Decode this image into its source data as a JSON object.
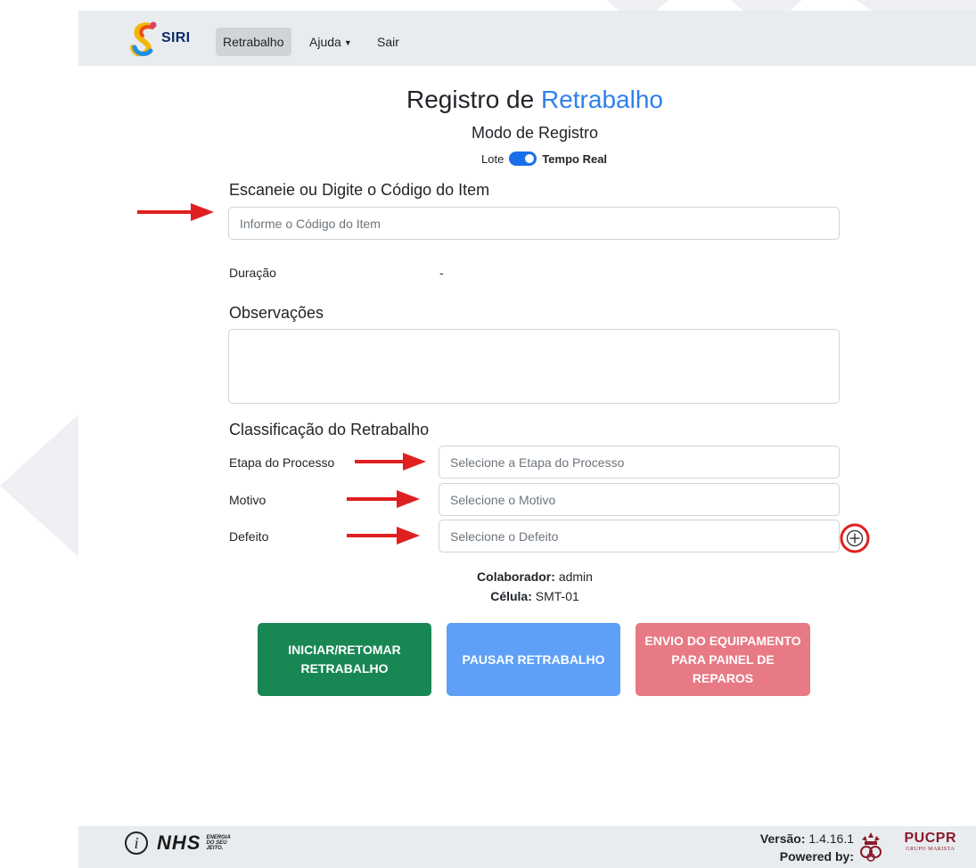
{
  "navbar": {
    "brand": "SIRI",
    "items": [
      {
        "label": "Retrabalho",
        "active": true
      },
      {
        "label": "Ajuda"
      },
      {
        "label": "Sair"
      }
    ]
  },
  "page": {
    "title_prefix": "Registro de",
    "title_accent": "Retrabalho",
    "subtitle": "Modo de Registro",
    "mode_off_label": "Lote",
    "mode_on_label": "Tempo Real",
    "mode_toggle_on": true
  },
  "item_code": {
    "label": "Escaneie ou Digite o Código do Item",
    "placeholder": "Informe o Código do Item",
    "value": ""
  },
  "duration": {
    "label": "Duração",
    "value": "-"
  },
  "observations": {
    "label": "Observações",
    "value": ""
  },
  "classification": {
    "title": "Classificação do Retrabalho",
    "fields": [
      {
        "label": "Etapa do Processo",
        "placeholder": "Selecione a Etapa do Processo"
      },
      {
        "label": "Motivo",
        "placeholder": "Selecione o Motivo"
      },
      {
        "label": "Defeito",
        "placeholder": "Selecione o Defeito"
      }
    ],
    "add_icon": "plus-circle-icon"
  },
  "info": {
    "collaborator_label": "Colaborador:",
    "collaborator_value": "admin",
    "cell_label": "Célula:",
    "cell_value": "SMT-01"
  },
  "actions": {
    "start": {
      "label": "INICIAR/RETOMAR RETRABALHO",
      "color": "#198754"
    },
    "pause": {
      "label": "PAUSAR RETRABALHO",
      "color": "#5ea0f7"
    },
    "send": {
      "label": "ENVIO DO EQUIPAMENTO PARA PAINEL DE REPAROS",
      "color": "#e77a84"
    }
  },
  "footer": {
    "info_icon": "info-icon",
    "nhs_mark": "NHS",
    "nhs_tagline_1": "ENERGIA",
    "nhs_tagline_2": "DO SEU",
    "nhs_tagline_3": "JEITO.",
    "version_label": "Versão:",
    "version_value": "1.4.16.1",
    "powered_by": "Powered by:",
    "sponsor": "PUCPR",
    "sponsor_group": "GRUPO MARISTA"
  },
  "colors": {
    "accent": "#2f80ed",
    "annotation": "#e02020"
  }
}
